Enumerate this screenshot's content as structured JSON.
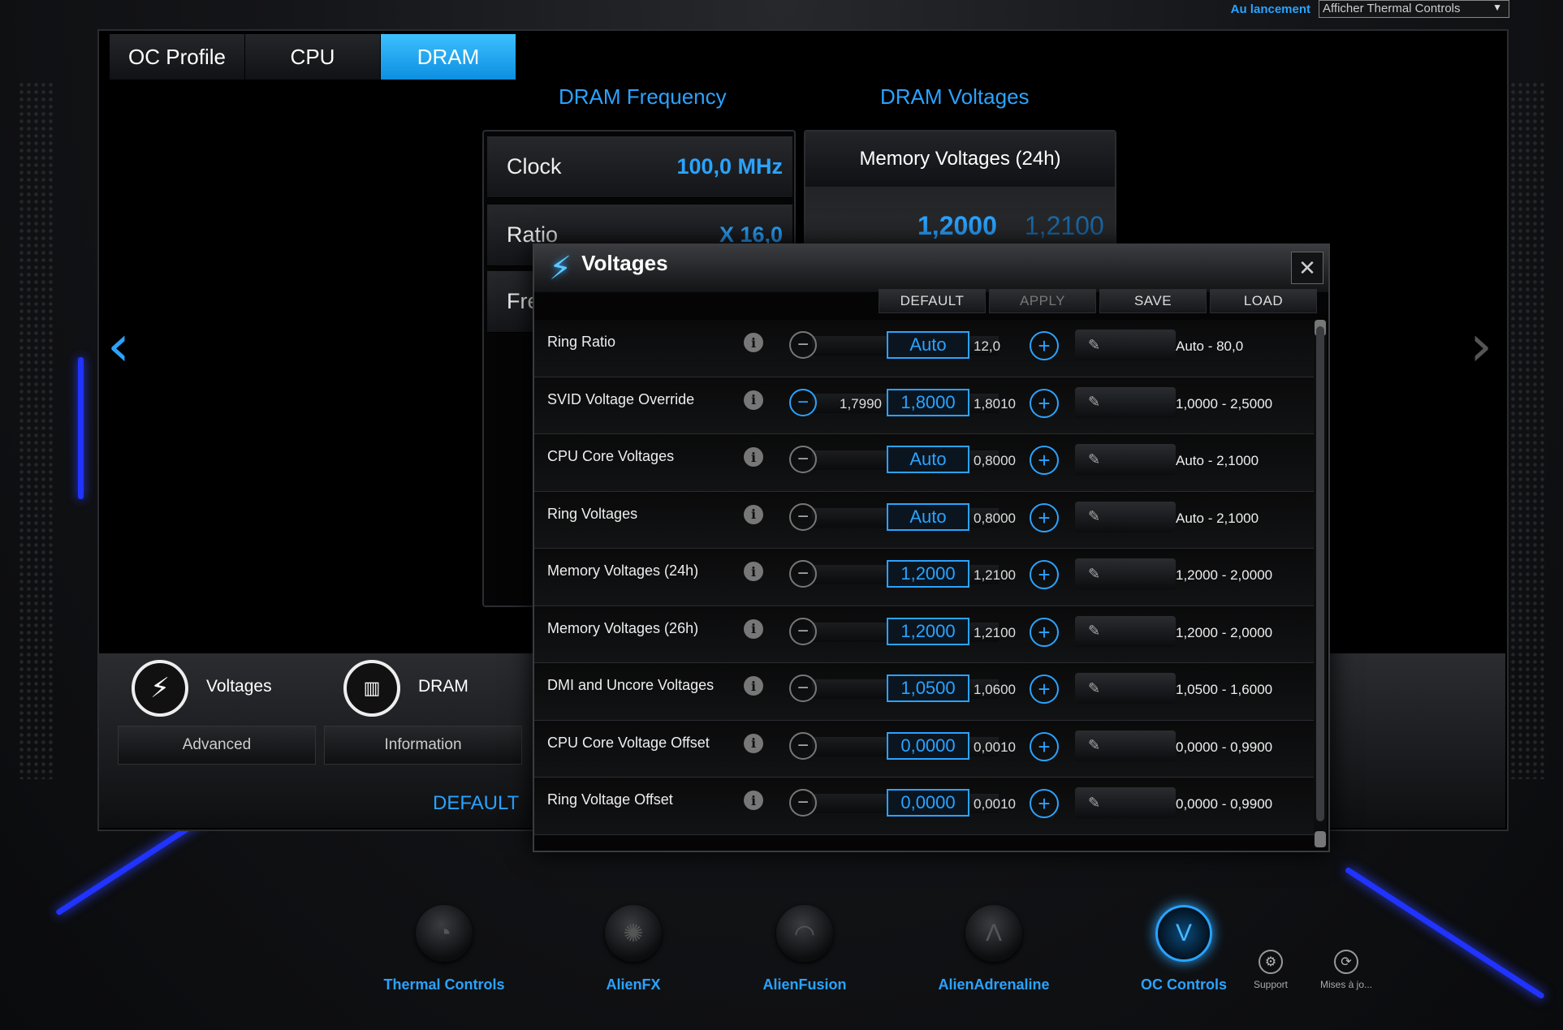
{
  "launch": {
    "label": "Au lancement",
    "value": "Afficher Thermal Controls"
  },
  "tabs": [
    "OC Profile",
    "CPU",
    "DRAM"
  ],
  "sections": {
    "frequency_title": "DRAM Frequency",
    "voltages_title": "DRAM Voltages"
  },
  "frequency_rows": [
    {
      "label": "Clock",
      "value": "100,0 MHz"
    },
    {
      "label": "Ratio",
      "value": "X 16,0"
    },
    {
      "label": "Fre",
      "value": ""
    }
  ],
  "dram_voltages": {
    "header": "Memory Voltages (24h)",
    "value": "1,2000",
    "next": "1,2100"
  },
  "bottom": {
    "voltages_label": "Voltages",
    "dram_label": "DRAM",
    "advanced": "Advanced",
    "information": "Information",
    "default": "DEFAULT"
  },
  "dialog": {
    "title": "Voltages",
    "buttons": {
      "default": "DEFAULT",
      "apply": "APPLY",
      "save": "SAVE",
      "load": "LOAD"
    },
    "rows": [
      {
        "name": "Ring Ratio",
        "prev": "",
        "current": "Auto",
        "next": "12,0",
        "range": "Auto - 80,0",
        "minus_active": false
      },
      {
        "name": "SVID Voltage Override",
        "prev": "1,7990",
        "current": "1,8000",
        "next": "1,8010",
        "range": "1,0000 - 2,5000",
        "minus_active": true
      },
      {
        "name": "CPU Core Voltages",
        "prev": "",
        "current": "Auto",
        "next": "0,8000",
        "range": "Auto - 2,1000",
        "minus_active": false
      },
      {
        "name": "Ring Voltages",
        "prev": "",
        "current": "Auto",
        "next": "0,8000",
        "range": "Auto - 2,1000",
        "minus_active": false
      },
      {
        "name": "Memory Voltages (24h)",
        "prev": "",
        "current": "1,2000",
        "next": "1,2100",
        "range": "1,2000 - 2,0000",
        "minus_active": false
      },
      {
        "name": "Memory Voltages (26h)",
        "prev": "",
        "current": "1,2000",
        "next": "1,2100",
        "range": "1,2000 - 2,0000",
        "minus_active": false
      },
      {
        "name": "DMI and Uncore Voltages",
        "prev": "",
        "current": "1,0500",
        "next": "1,0600",
        "range": "1,0500 - 1,6000",
        "minus_active": false
      },
      {
        "name": "CPU Core Voltage Offset",
        "prev": "",
        "current": "0,0000",
        "next": "0,0010",
        "range": "0,0000 - 0,9900",
        "minus_active": false
      },
      {
        "name": "Ring Voltage Offset",
        "prev": "",
        "current": "0,0000",
        "next": "0,0010",
        "range": "0,0000 - 0,9900",
        "minus_active": false
      }
    ]
  },
  "dock": [
    {
      "label": "Thermal Controls",
      "icon": "thermal-icon",
      "active": false
    },
    {
      "label": "AlienFX",
      "icon": "alienfx-icon",
      "active": false
    },
    {
      "label": "AlienFusion",
      "icon": "alienfusion-icon",
      "active": false
    },
    {
      "label": "AlienAdrenaline",
      "icon": "alienadrenaline-icon",
      "active": false
    },
    {
      "label": "OC Controls",
      "icon": "oc-controls-icon",
      "active": true
    }
  ],
  "mini": [
    {
      "label": "Support",
      "icon": "support-icon"
    },
    {
      "label": "Mises à jo...",
      "icon": "updates-icon"
    }
  ],
  "colors": {
    "accent": "#2aa3ff",
    "glow": "#2133ff"
  }
}
